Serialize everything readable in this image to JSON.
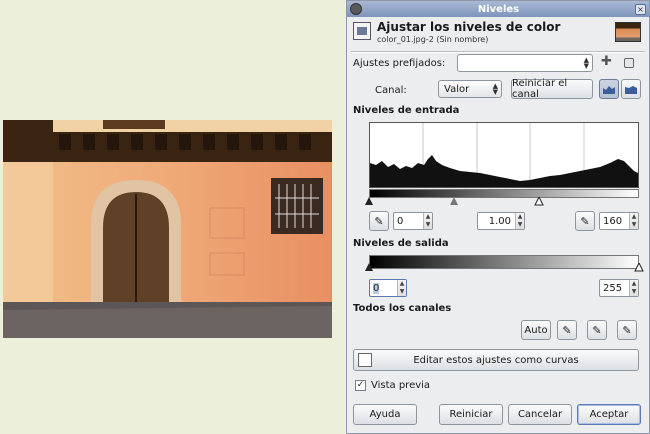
{
  "window": {
    "title": "Niveles"
  },
  "header": {
    "title": "Ajustar los niveles de color",
    "subtitle": "color_01.jpg-2 (Sin nombre)"
  },
  "presets": {
    "label": "Ajustes prefijados:",
    "value": ""
  },
  "channel": {
    "label": "Canal:",
    "value": "Valor",
    "reset_label": "Reiniciar el canal"
  },
  "input_levels": {
    "label": "Niveles de entrada",
    "low": "0",
    "gamma": "1.00",
    "high": "160"
  },
  "output_levels": {
    "label": "Niveles de salida",
    "low": "0",
    "high": "255"
  },
  "all_channels": {
    "label": "Todos los canales",
    "auto_label": "Auto"
  },
  "curves": {
    "label": "Editar estos ajustes como curvas"
  },
  "preview": {
    "label": "Vista previa",
    "checked": true
  },
  "buttons": {
    "help": "Ayuda",
    "reset": "Reiniciar",
    "cancel": "Cancelar",
    "accept": "Aceptar"
  },
  "colors": {
    "titlebar": "#8ea2c6",
    "dialog_bg": "#ecedee",
    "background": "#ecefd9"
  }
}
